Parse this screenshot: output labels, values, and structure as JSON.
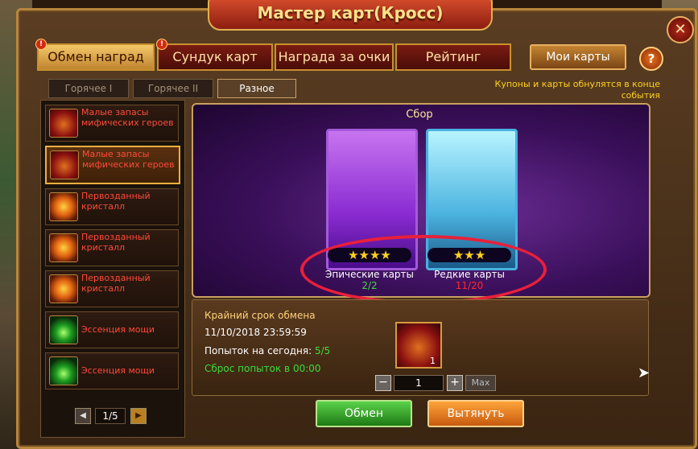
{
  "window": {
    "title": "Мастер карт(Кросс)",
    "close_icon": "close-icon"
  },
  "top_tabs": [
    {
      "label": "Обмен наград",
      "alert": "!",
      "active": true
    },
    {
      "label": "Сундук карт",
      "alert": "!"
    },
    {
      "label": "Награда за очки"
    },
    {
      "label": "Рейтинг"
    }
  ],
  "my_cards_label": "Мои карты",
  "help_label": "?",
  "sub_tabs": [
    {
      "label": "Горячее I"
    },
    {
      "label": "Горячее II"
    },
    {
      "label": "Разное",
      "active": true
    }
  ],
  "notice": "Купоны и карты обнулятся в конце события",
  "rewards": [
    {
      "label": "Малые запасы мифических героев",
      "icon": "chest-icon"
    },
    {
      "label": "Малые запасы мифических героев",
      "icon": "chest-icon",
      "selected": true
    },
    {
      "label": "Первозданный кристалл",
      "icon": "crystal-icon"
    },
    {
      "label": "Первозданный кристалл",
      "icon": "crystal-icon"
    },
    {
      "label": "Первозданный кристалл",
      "icon": "crystal-icon"
    },
    {
      "label": "Эссенция мощи",
      "icon": "essence-icon"
    },
    {
      "label": "Эссенция мощи",
      "icon": "essence-icon"
    }
  ],
  "pager": {
    "value": "1/5"
  },
  "collect": {
    "title": "Сбор",
    "epic": {
      "name": "Эпические карты",
      "count": "2/2",
      "stars": "★★★★",
      "count_color": "#3cdc3c"
    },
    "rare": {
      "name": "Редкие карты",
      "count": "11/20",
      "stars": "★★★",
      "count_color": "#ff2a2a"
    }
  },
  "exchange": {
    "deadline_label": "Крайний срок обмена",
    "deadline": "11/10/2018 23:59:59",
    "attempts_label": "Попыток на сегодня:",
    "attempts_value": "5/5",
    "reset": "Сброс попыток в 00:00",
    "prize_count": "1",
    "quantity": "1",
    "minus": "−",
    "plus": "+",
    "max": "Max",
    "exchange_button": "Обмен",
    "pull_button": "Вытянуть"
  }
}
